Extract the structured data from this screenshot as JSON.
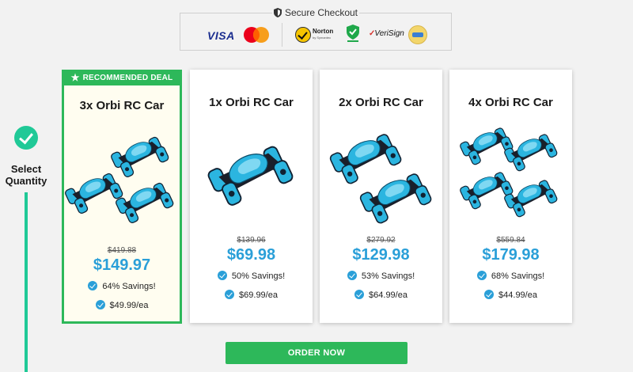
{
  "secure_checkout": {
    "title": "Secure Checkout",
    "visa_label": "VISA",
    "norton_name": "Norton",
    "norton_sub": "by Symantec",
    "verisign_label": "VeriSign"
  },
  "stepper": {
    "label_line1": "Select",
    "label_line2": "Quantity"
  },
  "recommended_label": "RECOMMENDED DEAL",
  "products": [
    {
      "title": "3x Orbi RC Car",
      "old_price": "$419.88",
      "price": "$149.97",
      "feature1": "64% Savings!",
      "feature2": "$49.99/ea",
      "qty": 3,
      "recommended": true
    },
    {
      "title": "1x Orbi RC Car",
      "old_price": "$139.96",
      "price": "$69.98",
      "feature1": "50% Savings!",
      "feature2": "$69.99/ea",
      "qty": 1,
      "recommended": false
    },
    {
      "title": "2x Orbi RC Car",
      "old_price": "$279.92",
      "price": "$129.98",
      "feature1": "53% Savings!",
      "feature2": "$64.99/ea",
      "qty": 2,
      "recommended": false
    },
    {
      "title": "4x Orbi RC Car",
      "old_price": "$559.84",
      "price": "$179.98",
      "feature1": "68% Savings!",
      "feature2": "$44.99/ea",
      "qty": 4,
      "recommended": false
    }
  ],
  "order_button": "ORDER NOW",
  "colors": {
    "accent_green": "#2db85a",
    "step_teal": "#20c997",
    "price_blue": "#2a9fd8",
    "car_body": "#2bb5e0"
  }
}
